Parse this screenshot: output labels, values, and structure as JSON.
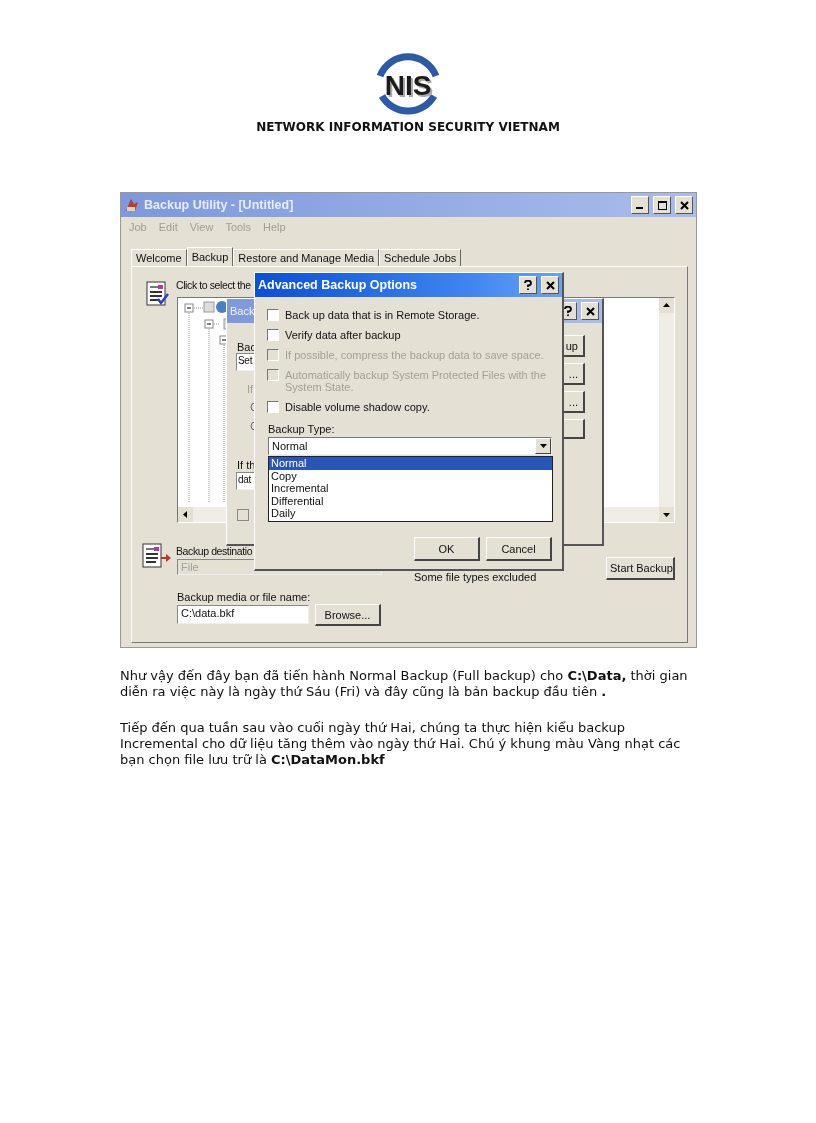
{
  "logo": {
    "text": "NIS"
  },
  "heading": "NETWORK INFORMATION SECURITY VIETNAM",
  "window": {
    "title": "Backup Utility - [Untitled]",
    "menu": [
      "Job",
      "Edit",
      "View",
      "Tools",
      "Help"
    ],
    "tabs": [
      {
        "label": "Welcome",
        "selected": false
      },
      {
        "label": "Backup",
        "selected": true
      },
      {
        "label": "Restore and Manage Media",
        "selected": false
      },
      {
        "label": "Schedule Jobs",
        "selected": false
      }
    ],
    "instruction": "Click to select the",
    "destination_label": "Backup destinatio",
    "destination_value": "File",
    "media_label": "Backup media or file name:",
    "media_value": "C:\\data.bkf",
    "browse_button": "Browse...",
    "status": "Some file types excluded",
    "start_button": "Start Backup"
  },
  "behind_dialog": {
    "title": "Back",
    "label_1": "Bac",
    "field_1": "Set",
    "group_label": "If",
    "label_2": "If th",
    "field_2": "dat",
    "checkbox": {
      "checked": false
    },
    "buttons": [
      "up",
      "...",
      "..."
    ]
  },
  "dialog": {
    "title": "Advanced Backup Options",
    "options": [
      {
        "label": "Back up data that is in Remote Storage.",
        "checked": false,
        "disabled": false
      },
      {
        "label": "Verify data after backup",
        "checked": false,
        "disabled": false
      },
      {
        "label": "If possible, compress the backup data to save space.",
        "checked": false,
        "disabled": true
      },
      {
        "label": "Automatically backup System Protected Files with the System State.",
        "checked": false,
        "disabled": true
      },
      {
        "label": "Disable volume shadow copy.",
        "checked": false,
        "disabled": false
      }
    ],
    "type_label": "Backup Type:",
    "type_value": "Normal",
    "type_options": [
      {
        "label": "Normal",
        "selected": true
      },
      {
        "label": "Copy",
        "selected": false
      },
      {
        "label": "Incremental",
        "selected": false
      },
      {
        "label": "Differential",
        "selected": false
      },
      {
        "label": "Daily",
        "selected": false
      }
    ],
    "buttons": [
      "OK",
      "Cancel"
    ]
  },
  "paragraphs": [
    "Như vậy đến đây bạn đã tiến hành Normal Backup (Full backup) cho **C:\\Data,** thời gian diễn ra việc này là ngày thứ Sáu (Fri) và đây cũng là bản backup đầu tiên **.**",
    "Tiếp đến qua tuần sau vào cuối ngày thứ Hai, chúng ta thực hiện kiểu backup Incremental cho dữ liệu tăng thêm vào ngày thứ Hai. Chú ý khung màu Vàng nhạt các bạn chọn file lưu trữ là **C:\\DataMon.bkf**"
  ]
}
